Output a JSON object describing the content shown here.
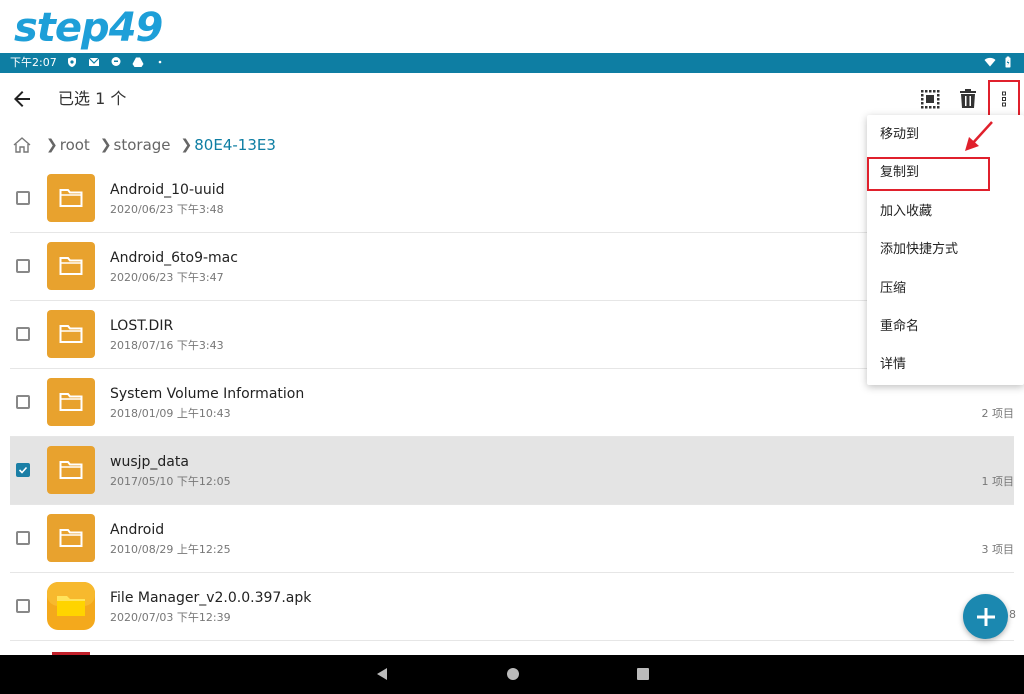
{
  "logo": {
    "text": "step49",
    "color": "#1e9fd8"
  },
  "status_bar": {
    "time": "下午2:07",
    "color": "#0e7ea3"
  },
  "toolbar": {
    "title": "已选 1 个",
    "icons": [
      "back-arrow-icon",
      "select-all-grid-icon",
      "trash-icon",
      "more-vert-icon"
    ]
  },
  "breadcrumb": {
    "items": [
      "root",
      "storage",
      "80E4-13E3"
    ],
    "home_icon": "home-icon"
  },
  "files": [
    {
      "name": "Android_10-uuid",
      "date": "2020/06/23 下午3:48",
      "count": "",
      "type": "folder",
      "checked": false
    },
    {
      "name": "Android_6to9-mac",
      "date": "2020/06/23 下午3:47",
      "count": "",
      "type": "folder",
      "checked": false
    },
    {
      "name": "LOST.DIR",
      "date": "2018/07/16 下午3:43",
      "count": "",
      "type": "folder",
      "checked": false
    },
    {
      "name": "System Volume Information",
      "date": "2018/01/09 上午10:43",
      "count": "2 项目",
      "type": "folder",
      "checked": false
    },
    {
      "name": "wusjp_data",
      "date": "2017/05/10 下午12:05",
      "count": "1 项目",
      "type": "folder",
      "checked": true
    },
    {
      "name": "Android",
      "date": "2010/08/29 上午12:25",
      "count": "3 项目",
      "type": "folder",
      "checked": false
    },
    {
      "name": "File Manager_v2.0.0.397.apk",
      "date": "2020/07/03 下午12:39",
      "count": "",
      "type": "apk",
      "checked": false
    }
  ],
  "menu": {
    "items": [
      "移动到",
      "复制到",
      "加入收藏",
      "添加快捷方式",
      "压缩",
      "重命名",
      "详情"
    ],
    "highlighted": "复制到"
  },
  "fab": {
    "label": "+",
    "color": "#1b88b0",
    "peek_text": "8"
  },
  "colors": {
    "accent": "#0e7ea3",
    "folder": "#e8a22e",
    "highlight": "#e0202c"
  }
}
